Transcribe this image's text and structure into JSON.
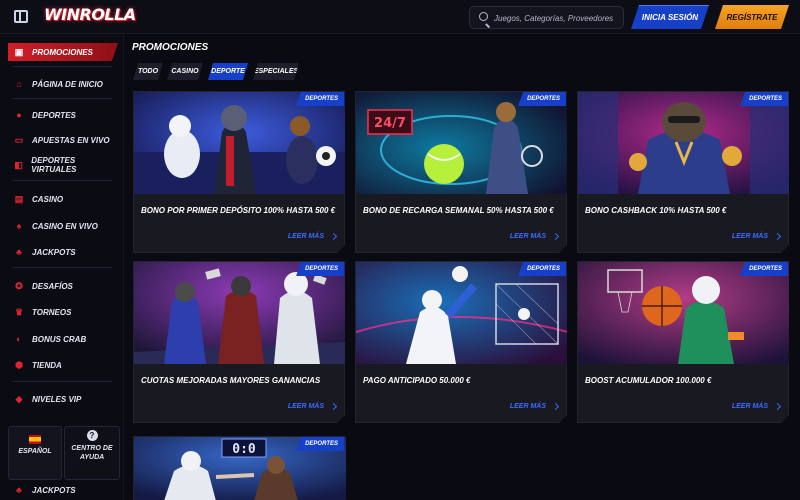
{
  "header": {
    "logo": "WINROLLA",
    "search_placeholder": "Juegos, Categorías, Proveedores",
    "login_label": "INICIA SESIÓN",
    "register_label": "REGÍSTRATE"
  },
  "sidebar": {
    "items": [
      {
        "label": "PROMOCIONES",
        "icon": "gift-icon"
      },
      {
        "label": "PÁGINA DE INICIO",
        "icon": "home-icon"
      },
      {
        "label": "DEPORTES",
        "icon": "ball-icon"
      },
      {
        "label": "APUESTAS EN VIVO",
        "icon": "live-bets-icon"
      },
      {
        "label": "DEPORTES VIRTUALES",
        "icon": "virtual-sports-icon"
      },
      {
        "label": "CASINO",
        "icon": "slot-icon"
      },
      {
        "label": "CASINO EN VIVO",
        "icon": "cards-icon"
      },
      {
        "label": "JACKPOTS",
        "icon": "clover-icon"
      },
      {
        "label": "DESAFÍOS",
        "icon": "challenge-icon"
      },
      {
        "label": "TORNEOS",
        "icon": "trophy-icon"
      },
      {
        "label": "BONUS CRAB",
        "icon": "crab-icon"
      },
      {
        "label": "TIENDA",
        "icon": "shop-icon"
      },
      {
        "label": "NIVELES VIP",
        "icon": "diamond-icon"
      },
      {
        "label": "JACKPOTS",
        "icon": "clover-icon"
      }
    ],
    "language_label": "ESPAÑOL",
    "help_label_1": "CENTRO DE",
    "help_label_2": "AYUDA"
  },
  "main": {
    "title": "PROMOCIONES",
    "tabs": [
      {
        "label": "TODO"
      },
      {
        "label": "CASINO"
      },
      {
        "label": "DEPORTE"
      },
      {
        "label": "ESPECIALES"
      }
    ],
    "active_tab": "DEPORTE",
    "cards": [
      {
        "badge": "DEPORTES",
        "title": "BONO POR PRIMER DEPÓSITO 100% HASTA 500 €",
        "more": "LEER MÁS"
      },
      {
        "badge": "DEPORTES",
        "title": "BONO DE RECARGA SEMANAL 50% HASTA 500 €",
        "more": "LEER MÁS",
        "art_text": "24/7"
      },
      {
        "badge": "DEPORTES",
        "title": "BONO CASHBACK 10% HASTA 500 €",
        "more": "LEER MÁS"
      },
      {
        "badge": "DEPORTES",
        "title": "CUOTAS MEJORADAS MAYORES GANANCIAS",
        "more": "LEER MÁS"
      },
      {
        "badge": "DEPORTES",
        "title": "PAGO ANTICIPADO 50.000 €",
        "more": "LEER MÁS"
      },
      {
        "badge": "DEPORTES",
        "title": "BOOST ACUMULADOR 100.000 €",
        "more": "LEER MÁS"
      },
      {
        "badge": "DEPORTES",
        "art_text": "0:0"
      }
    ]
  },
  "colors": {
    "accent_red": "#d11f29",
    "accent_blue": "#1740c9",
    "accent_orange": "#f39a1c",
    "background": "#0a0a12"
  }
}
